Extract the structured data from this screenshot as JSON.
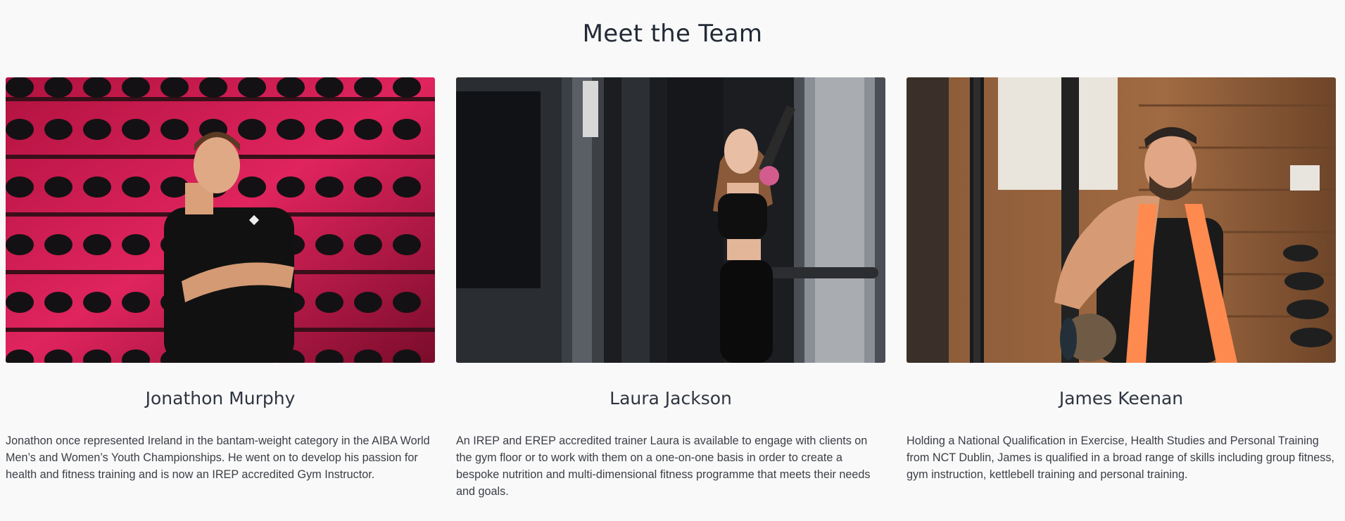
{
  "section": {
    "title": "Meet the Team"
  },
  "team": [
    {
      "name": "Jonathon Murphy",
      "bio": "Jonathon once represented Ireland in the bantam-weight category in the AIBA World Men’s and Women’s Youth Championships. He went on to develop his passion for health and fitness training and is now an IREP accredited Gym Instructor.",
      "photo": "trainer-photo-boxing-gloves-wall"
    },
    {
      "name": "Laura Jackson",
      "bio": "An IREP and EREP accredited trainer Laura is available to engage with clients on the gym floor or to work with them on a one-on-one basis in order to create a bespoke nutrition and multi-dimensional fitness programme that meets their needs and goals.",
      "photo": "trainer-photo-cable-machine"
    },
    {
      "name": "James Keenan",
      "bio": "Holding a National Qualification in Exercise, Health Studies and Personal Training from NCT Dublin, James is qualified in a broad range of skills including group fitness, gym instruction, kettlebell training and personal training.",
      "photo": "trainer-photo-towel-gym"
    }
  ],
  "colors": {
    "background": "#f9f9f9",
    "heading": "#232a36",
    "body_text": "#3b3f46"
  }
}
